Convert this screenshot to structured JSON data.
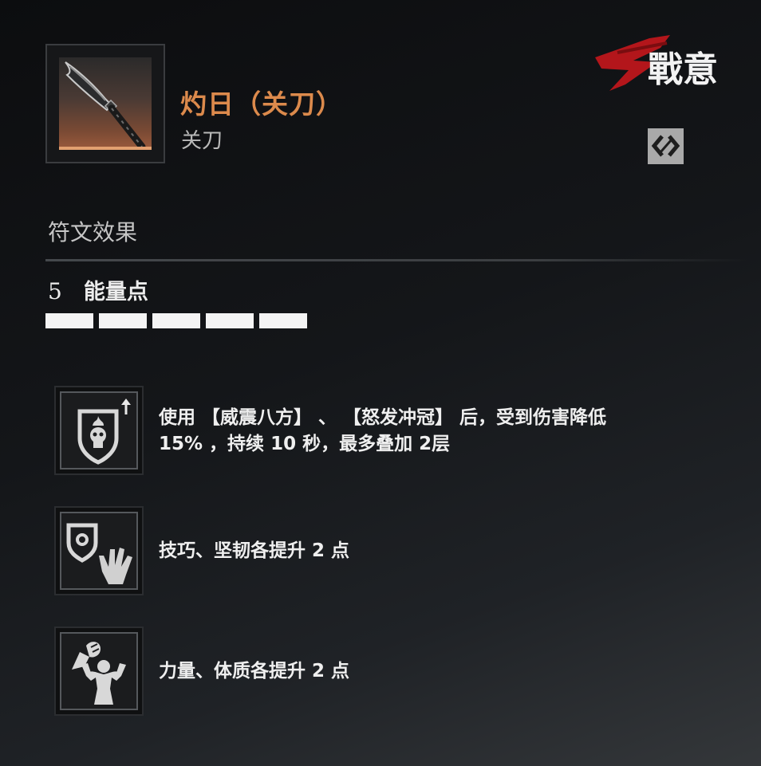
{
  "weapon": {
    "name": "灼日（关刀）",
    "type": "关刀",
    "icon": "guandao-blade-icon"
  },
  "logo": {
    "text": "戰意"
  },
  "swap_button": {
    "icon": "swap-arrows-icon"
  },
  "rune_section": {
    "title": "符文效果",
    "energy_count": "5",
    "energy_label": "能量点",
    "energy_segments": 5
  },
  "perks": [
    {
      "icon": "shield-skull-icon",
      "line1": "使用 【威震八方】 、 【怒发冲冠】 后，受到伤害降低",
      "line2": "15% ，持续 10 秒，最多叠加 2层"
    },
    {
      "icon": "shield-hand-icon",
      "line1": "技巧、坚韧各提升 2 点"
    },
    {
      "icon": "fist-flex-icon",
      "line1": "力量、体质各提升 2 点"
    }
  ],
  "colors": {
    "name_accent": "#dc8a4c",
    "background": "#141619",
    "logo_red": "#b3161b"
  }
}
